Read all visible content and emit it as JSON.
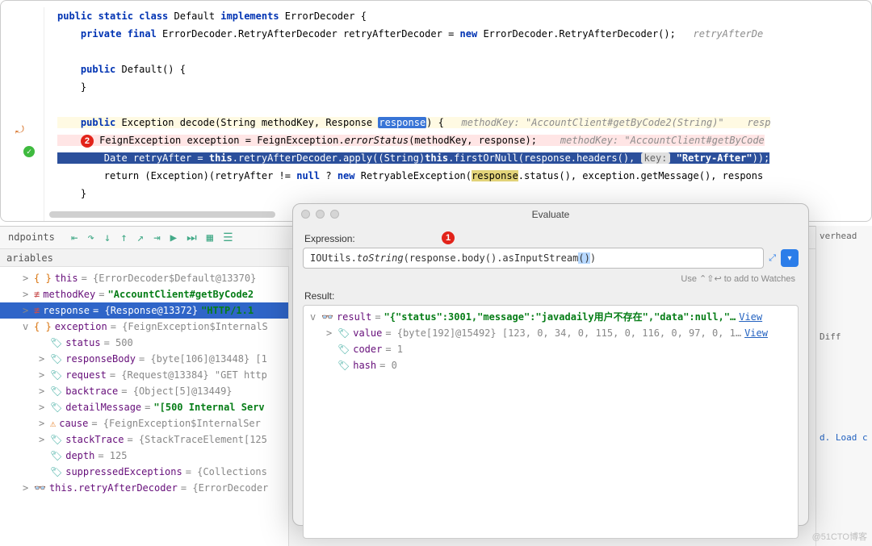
{
  "editor": {
    "l1": {
      "pre": "public static class ",
      "cls": "Default ",
      "imp": "implements ",
      "iface": "ErrorDecoder {"
    },
    "l2": {
      "pre": "    private final ",
      "type": "ErrorDecoder.RetryAfterDecoder ",
      "name": "retryAfterDecoder",
      "eq": " = ",
      "kw": "new ",
      "ctor": "ErrorDecoder.RetryAfterDecoder();",
      "cmt": "   retryAfterDe"
    },
    "l3": "",
    "l4": {
      "pre": "    public ",
      "n": "Default() {"
    },
    "l5": "    }",
    "l6": "",
    "l7": {
      "pre": "    public ",
      "ret": "Exception ",
      "name": "decode(String methodKey, Response ",
      "param": "response",
      "tail": ") {",
      "cmt": "   methodKey: \"AccountClient#getByCode2(String)\"    resp"
    },
    "l8": {
      "badge": "2",
      "txt": " FeignException exception = FeignException.",
      "it": "errorStatus",
      "tail": "(methodKey, response);",
      "cmt": "    methodKey: \"AccountClient#getByCode"
    },
    "l9": {
      "pre": "        Date retryAfter = ",
      "kw": "this",
      ".": ".retryAfterDecoder.apply((String)",
      "kw2": "this",
      "tail": ".firstOrNull(response.headers(), ",
      "chip": "key:",
      "str": " \"Retry-After\"",
      "end": "));"
    },
    "l10": {
      "pre": "        return ",
      "cast": "(Exception)(retryAfter != ",
      "kw": "null",
      "q": " ? ",
      "kw2": "new ",
      "ctor": "RetryableException(",
      "hl": "response",
      "tail": ".status(), exception.getMessage(), respons"
    },
    "l11": "    }"
  },
  "debug": {
    "tab_breakpoints": "ndpoints",
    "variables_header": "ariables",
    "toolbar_icons": [
      "⇤",
      "↷",
      "↓",
      "↑",
      "↗",
      "⇥",
      "▶",
      "⏭",
      "▦",
      "☰"
    ],
    "tree": [
      {
        "lvl": 0,
        "arrow": ">",
        "ico": "obj",
        "name": "this",
        "val": " = {ErrorDecoder$Default@13370}"
      },
      {
        "lvl": 0,
        "arrow": ">",
        "ico": "eq",
        "name": "methodKey",
        "val": " = ",
        "str": "\"AccountClient#getByCode2"
      },
      {
        "lvl": 0,
        "arrow": ">",
        "ico": "eq",
        "name": "response",
        "val": " = {Response@13372} ",
        "str": "\"HTTP/1.1",
        "sel": true
      },
      {
        "lvl": 0,
        "arrow": "v",
        "ico": "obj",
        "name": "exception",
        "val": " = {FeignException$InternalS"
      },
      {
        "lvl": 1,
        "arrow": "",
        "ico": "fld",
        "name": "status",
        "val": " = 500"
      },
      {
        "lvl": 1,
        "arrow": ">",
        "ico": "fld",
        "name": "responseBody",
        "val": " = {byte[106]@13448} [1"
      },
      {
        "lvl": 1,
        "arrow": ">",
        "ico": "fld",
        "name": "request",
        "val": " = {Request@13384} \"GET http"
      },
      {
        "lvl": 1,
        "arrow": ">",
        "ico": "fld",
        "name": "backtrace",
        "val": " = {Object[5]@13449}"
      },
      {
        "lvl": 1,
        "arrow": ">",
        "ico": "fld",
        "name": "detailMessage",
        "val": " = ",
        "str": "\"[500 Internal Serv"
      },
      {
        "lvl": 1,
        "arrow": ">",
        "ico": "eye",
        "name": "cause",
        "val": " = {FeignException$InternalSer"
      },
      {
        "lvl": 1,
        "arrow": ">",
        "ico": "fld",
        "name": "stackTrace",
        "val": " = {StackTraceElement[125"
      },
      {
        "lvl": 1,
        "arrow": "",
        "ico": "fld",
        "name": "depth",
        "val": " = 125"
      },
      {
        "lvl": 1,
        "arrow": "",
        "ico": "fld",
        "name": "suppressedExceptions",
        "val": " = {Collections"
      },
      {
        "lvl": 0,
        "arrow": ">",
        "ico": "glsn",
        "name": "this.retryAfterDecoder",
        "val": " = {ErrorDecoder"
      }
    ]
  },
  "evaluate": {
    "title": "Evaluate",
    "expr_label": "Expression:",
    "badge": "1",
    "expr": {
      "pre": "IOUtils.",
      "it": "toString",
      "mid": "(response.body().asInputStream",
      "p1": "(",
      "p2": ")",
      ")": ")"
    },
    "expand_icon": "⤢",
    "hint": "Use ⌃⇧↩ to add to Watches",
    "result_label": "Result:",
    "rows": [
      {
        "lvl": 0,
        "arrow": "v",
        "ico": "glsn",
        "name": "result",
        "val": " = ",
        "str": "\"{\"status\":3001,\"message\":\"javadaily用户不存在\",\"data\":null,\"…",
        "link": "View"
      },
      {
        "lvl": 1,
        "arrow": ">",
        "ico": "fld",
        "name": "value",
        "val": " = {byte[192]@15492} [123, 0, 34, 0, 115, 0, 116, 0, 97, 0, 1…",
        "link": "View"
      },
      {
        "lvl": 1,
        "arrow": "",
        "ico": "fld",
        "name": "coder",
        "val": " = 1"
      },
      {
        "lvl": 1,
        "arrow": "",
        "ico": "fld",
        "name": "hash",
        "val": " = 0"
      }
    ]
  },
  "right": {
    "overhead": "verhead",
    "diff": "Diff",
    "load": "d. Load c"
  },
  "watermark": "@51CTO博客"
}
